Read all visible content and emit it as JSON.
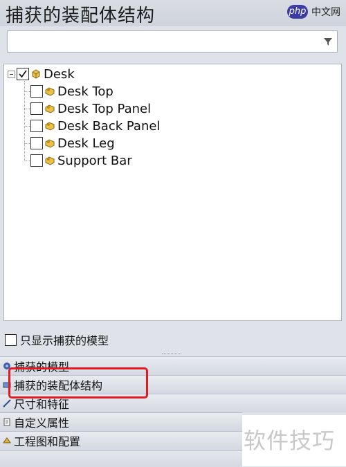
{
  "header": {
    "title": "捕获的装配体结构",
    "site_logo": "php",
    "site_name": "中文网"
  },
  "filter": {
    "value": "",
    "placeholder": ""
  },
  "tree": {
    "root": {
      "label": "Desk",
      "checked": true,
      "expanded": true
    },
    "children": [
      {
        "label": "Desk Top",
        "checked": false
      },
      {
        "label": "Desk Top Panel",
        "checked": false
      },
      {
        "label": "Desk Back Panel",
        "checked": false
      },
      {
        "label": "Desk Leg",
        "checked": false
      },
      {
        "label": "Support Bar",
        "checked": false
      }
    ]
  },
  "options": {
    "only_captured_label": "只显示捕获的模型",
    "only_captured_checked": false
  },
  "sections": [
    {
      "label": "捕获的模型",
      "icon": "captured-model-icon"
    },
    {
      "label": "捕获的装配体结构",
      "icon": "assembly-structure-icon"
    },
    {
      "label": "尺寸和特征",
      "icon": "dimension-icon"
    },
    {
      "label": "自定义属性",
      "icon": "properties-icon"
    },
    {
      "label": "工程图和配置",
      "icon": "drawing-config-icon"
    }
  ],
  "watermark": "软件技巧",
  "colors": {
    "highlight": "#e11b24",
    "background": "#dfe2e8"
  }
}
